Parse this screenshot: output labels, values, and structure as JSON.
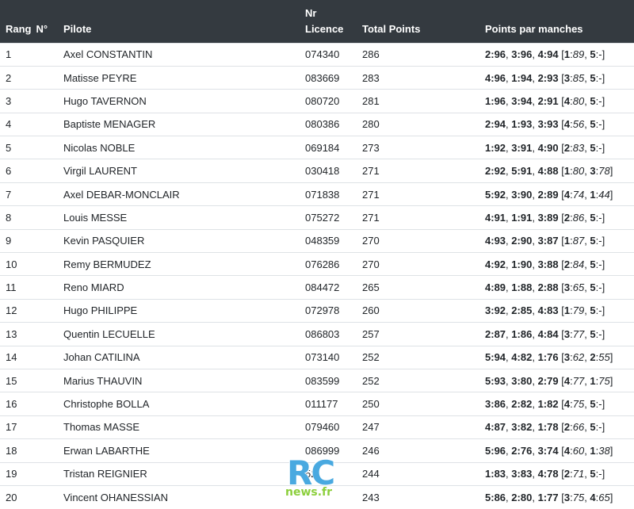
{
  "headers": {
    "rang": "Rang",
    "no": "N°",
    "pilote": "Pilote",
    "licence_line1": "Nr",
    "licence_line2": "Licence",
    "total": "Total Points",
    "manches": "Points par manches"
  },
  "rows": [
    {
      "rang": "1",
      "pilote": "Axel CONSTANTIN",
      "licence": "074340",
      "total": "286",
      "manches": [
        [
          "2",
          "96"
        ],
        [
          "3",
          "96"
        ],
        [
          "4",
          "94"
        ]
      ],
      "extra": [
        [
          "1",
          "89"
        ],
        [
          "5",
          "-"
        ]
      ]
    },
    {
      "rang": "2",
      "pilote": "Matisse PEYRE",
      "licence": "083669",
      "total": "283",
      "manches": [
        [
          "4",
          "96"
        ],
        [
          "1",
          "94"
        ],
        [
          "2",
          "93"
        ]
      ],
      "extra": [
        [
          "3",
          "85"
        ],
        [
          "5",
          "-"
        ]
      ]
    },
    {
      "rang": "3",
      "pilote": "Hugo TAVERNON",
      "licence": "080720",
      "total": "281",
      "manches": [
        [
          "1",
          "96"
        ],
        [
          "3",
          "94"
        ],
        [
          "2",
          "91"
        ]
      ],
      "extra": [
        [
          "4",
          "80"
        ],
        [
          "5",
          "-"
        ]
      ]
    },
    {
      "rang": "4",
      "pilote": "Baptiste MENAGER",
      "licence": "080386",
      "total": "280",
      "manches": [
        [
          "2",
          "94"
        ],
        [
          "1",
          "93"
        ],
        [
          "3",
          "93"
        ]
      ],
      "extra": [
        [
          "4",
          "56"
        ],
        [
          "5",
          "-"
        ]
      ]
    },
    {
      "rang": "5",
      "pilote": "Nicolas NOBLE",
      "licence": "069184",
      "total": "273",
      "manches": [
        [
          "1",
          "92"
        ],
        [
          "3",
          "91"
        ],
        [
          "4",
          "90"
        ]
      ],
      "extra": [
        [
          "2",
          "83"
        ],
        [
          "5",
          "-"
        ]
      ]
    },
    {
      "rang": "6",
      "pilote": "Virgil LAURENT",
      "licence": "030418",
      "total": "271",
      "manches": [
        [
          "2",
          "92"
        ],
        [
          "5",
          "91"
        ],
        [
          "4",
          "88"
        ]
      ],
      "extra": [
        [
          "1",
          "80"
        ],
        [
          "3",
          "78"
        ]
      ]
    },
    {
      "rang": "7",
      "pilote": "Axel DEBAR-MONCLAIR",
      "licence": "071838",
      "total": "271",
      "manches": [
        [
          "5",
          "92"
        ],
        [
          "3",
          "90"
        ],
        [
          "2",
          "89"
        ]
      ],
      "extra": [
        [
          "4",
          "74"
        ],
        [
          "1",
          "44"
        ]
      ]
    },
    {
      "rang": "8",
      "pilote": "Louis MESSE",
      "licence": "075272",
      "total": "271",
      "manches": [
        [
          "4",
          "91"
        ],
        [
          "1",
          "91"
        ],
        [
          "3",
          "89"
        ]
      ],
      "extra": [
        [
          "2",
          "86"
        ],
        [
          "5",
          "-"
        ]
      ]
    },
    {
      "rang": "9",
      "pilote": "Kevin PASQUIER",
      "licence": "048359",
      "total": "270",
      "manches": [
        [
          "4",
          "93"
        ],
        [
          "2",
          "90"
        ],
        [
          "3",
          "87"
        ]
      ],
      "extra": [
        [
          "1",
          "87"
        ],
        [
          "5",
          "-"
        ]
      ]
    },
    {
      "rang": "10",
      "pilote": "Remy BERMUDEZ",
      "licence": "076286",
      "total": "270",
      "manches": [
        [
          "4",
          "92"
        ],
        [
          "1",
          "90"
        ],
        [
          "3",
          "88"
        ]
      ],
      "extra": [
        [
          "2",
          "84"
        ],
        [
          "5",
          "-"
        ]
      ]
    },
    {
      "rang": "11",
      "pilote": "Reno MIARD",
      "licence": "084472",
      "total": "265",
      "manches": [
        [
          "4",
          "89"
        ],
        [
          "1",
          "88"
        ],
        [
          "2",
          "88"
        ]
      ],
      "extra": [
        [
          "3",
          "65"
        ],
        [
          "5",
          "-"
        ]
      ]
    },
    {
      "rang": "12",
      "pilote": "Hugo PHILIPPE",
      "licence": "072978",
      "total": "260",
      "manches": [
        [
          "3",
          "92"
        ],
        [
          "2",
          "85"
        ],
        [
          "4",
          "83"
        ]
      ],
      "extra": [
        [
          "1",
          "79"
        ],
        [
          "5",
          "-"
        ]
      ]
    },
    {
      "rang": "13",
      "pilote": "Quentin LECUELLE",
      "licence": "086803",
      "total": "257",
      "manches": [
        [
          "2",
          "87"
        ],
        [
          "1",
          "86"
        ],
        [
          "4",
          "84"
        ]
      ],
      "extra": [
        [
          "3",
          "77"
        ],
        [
          "5",
          "-"
        ]
      ]
    },
    {
      "rang": "14",
      "pilote": "Johan CATILINA",
      "licence": "073140",
      "total": "252",
      "manches": [
        [
          "5",
          "94"
        ],
        [
          "4",
          "82"
        ],
        [
          "1",
          "76"
        ]
      ],
      "extra": [
        [
          "3",
          "62"
        ],
        [
          "2",
          "55"
        ]
      ]
    },
    {
      "rang": "15",
      "pilote": "Marius THAUVIN",
      "licence": "083599",
      "total": "252",
      "manches": [
        [
          "5",
          "93"
        ],
        [
          "3",
          "80"
        ],
        [
          "2",
          "79"
        ]
      ],
      "extra": [
        [
          "4",
          "77"
        ],
        [
          "1",
          "75"
        ]
      ]
    },
    {
      "rang": "16",
      "pilote": "Christophe BOLLA",
      "licence": "011177",
      "total": "250",
      "manches": [
        [
          "3",
          "86"
        ],
        [
          "2",
          "82"
        ],
        [
          "1",
          "82"
        ]
      ],
      "extra": [
        [
          "4",
          "75"
        ],
        [
          "5",
          "-"
        ]
      ]
    },
    {
      "rang": "17",
      "pilote": "Thomas MASSE",
      "licence": "079460",
      "total": "247",
      "manches": [
        [
          "4",
          "87"
        ],
        [
          "3",
          "82"
        ],
        [
          "1",
          "78"
        ]
      ],
      "extra": [
        [
          "2",
          "66"
        ],
        [
          "5",
          "-"
        ]
      ]
    },
    {
      "rang": "18",
      "pilote": "Erwan LABARTHE",
      "licence": "086999",
      "total": "246",
      "manches": [
        [
          "5",
          "96"
        ],
        [
          "2",
          "76"
        ],
        [
          "3",
          "74"
        ]
      ],
      "extra": [
        [
          "4",
          "60"
        ],
        [
          "1",
          "38"
        ]
      ]
    },
    {
      "rang": "19",
      "pilote": "Tristan REIGNIER",
      "licence": "52",
      "total": "244",
      "manches": [
        [
          "1",
          "83"
        ],
        [
          "3",
          "83"
        ],
        [
          "4",
          "78"
        ]
      ],
      "extra": [
        [
          "2",
          "71"
        ],
        [
          "5",
          "-"
        ]
      ]
    },
    {
      "rang": "20",
      "pilote": "Vincent OHANESSIAN",
      "licence": "",
      "total": "243",
      "manches": [
        [
          "5",
          "86"
        ],
        [
          "2",
          "80"
        ],
        [
          "1",
          "77"
        ]
      ],
      "extra": [
        [
          "3",
          "75"
        ],
        [
          "4",
          "65"
        ]
      ]
    }
  ],
  "watermark": {
    "rc": "RC",
    "news": "news.fr",
    "rc_color": "#49a9e0",
    "news_color": "#8ccf3c"
  },
  "colors": {
    "header_bg": "#343a40",
    "header_text": "#ffffff",
    "border": "#dee2e6",
    "text": "#212529"
  }
}
